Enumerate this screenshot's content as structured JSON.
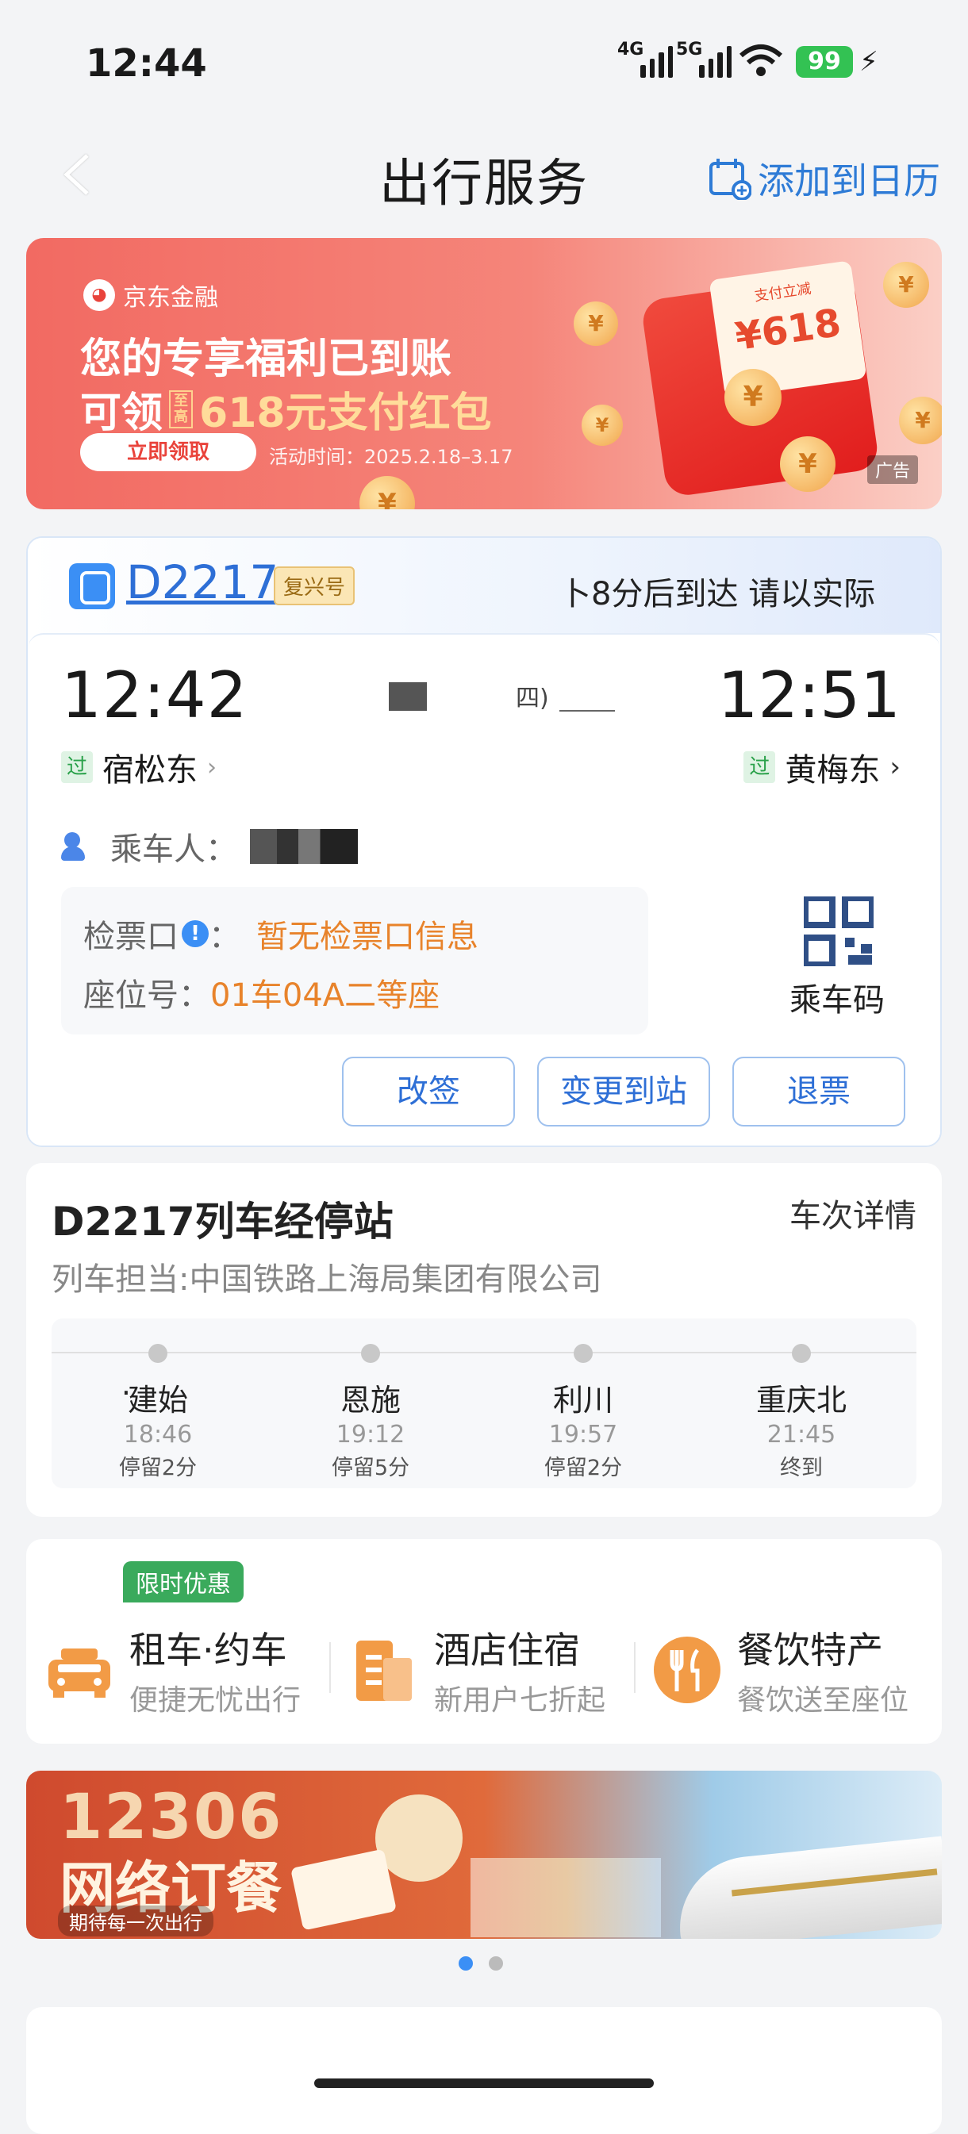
{
  "status": {
    "time": "12:44",
    "net1": "4G",
    "net2": "5G",
    "battery": "99"
  },
  "nav": {
    "title": "出行服务",
    "calendar_label": "添加到日历"
  },
  "ad_top": {
    "brand": "京东金融",
    "line1": "您的专享福利已到账",
    "line2_pre": "可领",
    "line2_tag": "至高",
    "line2_hl": "618元支付红包",
    "button": "立即领取",
    "period": "活动时间：2025.2.18–3.17",
    "ad_tag": "广告",
    "ticket_top": "支付立减",
    "ticket_amount": "¥618"
  },
  "trip": {
    "train_no": "D2217",
    "train_type": "复兴号",
    "notice": "卜8分后到达 请以实际",
    "dep_time": "12:42",
    "arr_time": "12:51",
    "dep_station": "宿松东",
    "arr_station": "黄梅东",
    "pass_tag": "过",
    "mid_text": "四)",
    "passenger_label": "乘车人：",
    "gate_label": "检票口",
    "gate_value": "暂无检票口信息",
    "seat_label": "座位号：",
    "seat_value": "01车04A二等座",
    "qr_label": "乘车码",
    "buttons": [
      "改签",
      "变更到站",
      "退票"
    ]
  },
  "stops": {
    "title": "D2217列车经停站",
    "detail": "车次详情",
    "operator": "列车担当:中国铁路上海局集团有限公司",
    "items": [
      {
        "name": "建始",
        "time": "18:46",
        "dwell": "停留2分"
      },
      {
        "name": "恩施",
        "time": "19:12",
        "dwell": "停留5分"
      },
      {
        "name": "利川",
        "time": "19:57",
        "dwell": "停留2分"
      },
      {
        "name": "重庆北",
        "time": "21:45",
        "dwell": "终到"
      }
    ]
  },
  "services": {
    "promo": "限时优惠",
    "items": [
      {
        "title": "租车·约车",
        "sub": "便捷无忧出行",
        "icon": "car-icon"
      },
      {
        "title": "酒店住宿",
        "sub": "新用户七折起",
        "icon": "hotel-icon"
      },
      {
        "title": "餐饮特产",
        "sub": "餐饮送至座位",
        "icon": "dining-icon"
      }
    ]
  },
  "ad_bottom": {
    "line1": "12306",
    "line2": "网络订餐",
    "slogan": "期待每一次出行"
  }
}
